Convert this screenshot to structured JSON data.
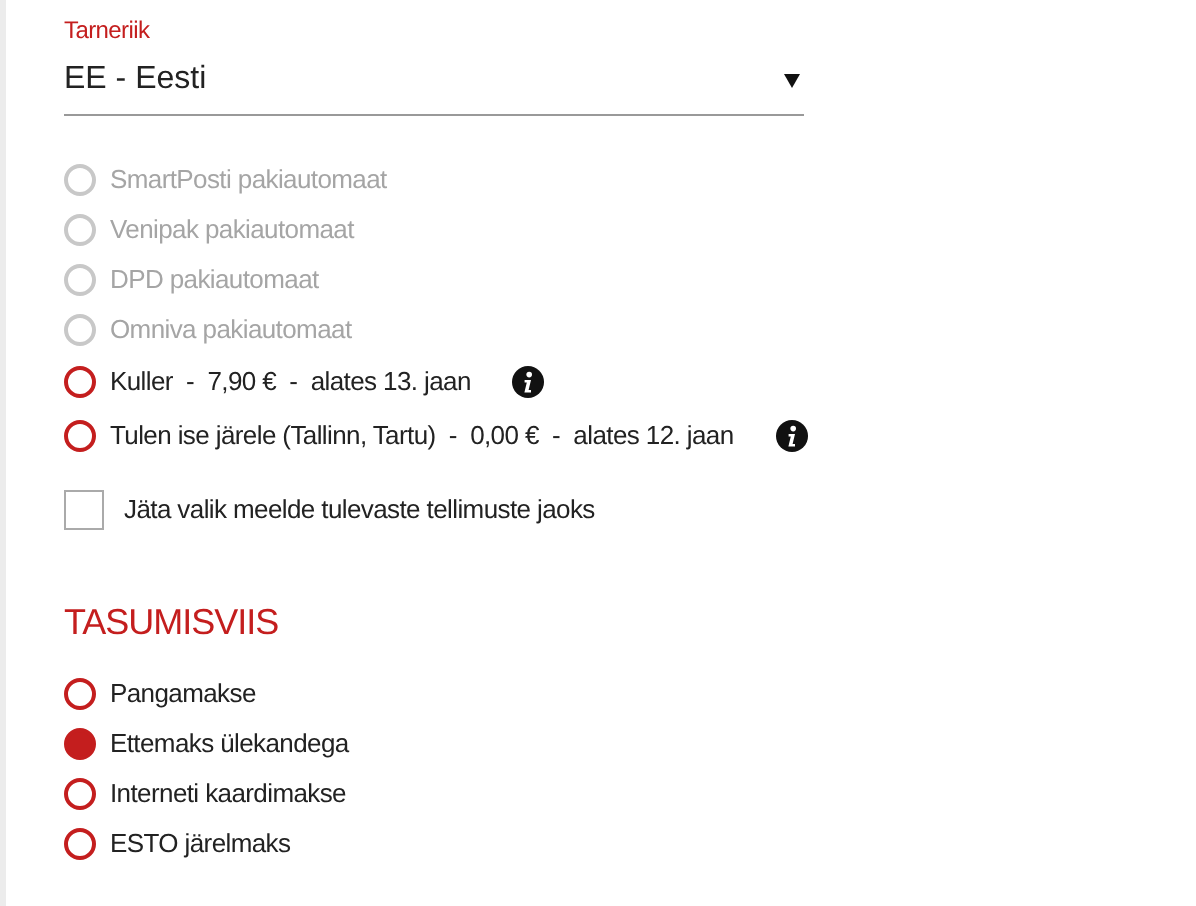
{
  "carrier": {
    "label": "Tarneriik",
    "value": "EE - Eesti"
  },
  "shipping_options": [
    {
      "label": "SmartPosti pakiautomaat",
      "disabled": true,
      "selected": false,
      "info": false
    },
    {
      "label": "Venipak pakiautomaat",
      "disabled": true,
      "selected": false,
      "info": false
    },
    {
      "label": "DPD pakiautomaat",
      "disabled": true,
      "selected": false,
      "info": false
    },
    {
      "label": "Omniva pakiautomaat",
      "disabled": true,
      "selected": false,
      "info": false
    },
    {
      "label": "Kuller  -  7,90 €  -  alates 13. jaan",
      "disabled": false,
      "selected": false,
      "info": true
    },
    {
      "label": "Tulen ise järele (Tallinn, Tartu)  -  0,00 €  -  alates 12. jaan",
      "disabled": false,
      "selected": false,
      "info": true
    }
  ],
  "remember": {
    "label": "Jäta valik meelde tulevaste tellimuste jaoks",
    "checked": false
  },
  "payment": {
    "heading": "TASUMISVIIS",
    "options": [
      {
        "label": "Pangamakse",
        "selected": false
      },
      {
        "label": "Ettemaks ülekandega",
        "selected": true
      },
      {
        "label": "Interneti kaardimakse",
        "selected": false
      },
      {
        "label": "ESTO järelmaks",
        "selected": false
      }
    ]
  }
}
